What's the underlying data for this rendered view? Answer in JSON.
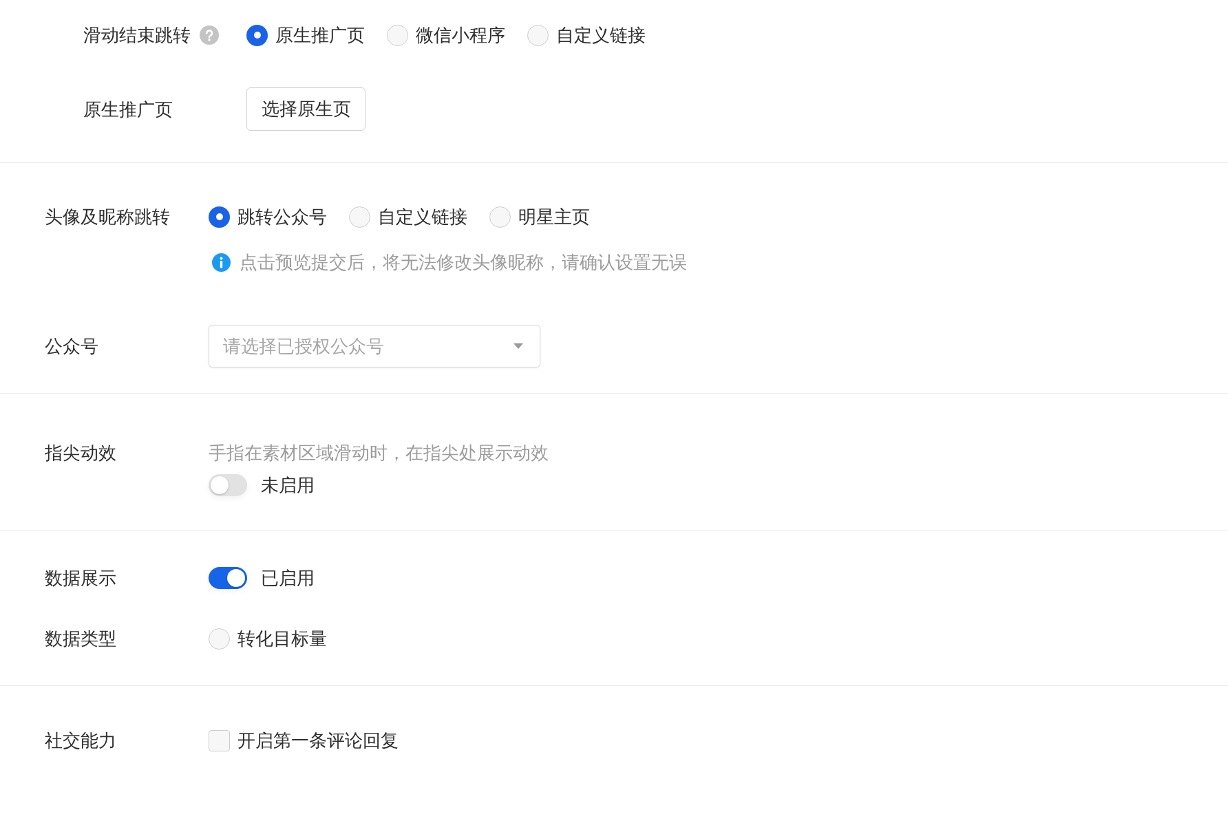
{
  "sections": [
    {
      "kind": "subform",
      "rows": [
        {
          "kind": "radio",
          "label": "滑动结束跳转",
          "help": true,
          "options": [
            {
              "label": "原生推广页",
              "selected": true
            },
            {
              "label": "微信小程序",
              "selected": false
            },
            {
              "label": "自定义链接",
              "selected": false
            }
          ]
        },
        {
          "kind": "button",
          "label": "原生推广页",
          "button": "选择原生页"
        }
      ]
    },
    {
      "kind": "form",
      "rows": [
        {
          "kind": "radio",
          "label": "头像及昵称跳转",
          "options": [
            {
              "label": "跳转公众号",
              "selected": true
            },
            {
              "label": "自定义链接",
              "selected": false
            },
            {
              "label": "明星主页",
              "selected": false
            }
          ],
          "notice": "点击预览提交后，将无法修改头像昵称，请确认设置无误"
        },
        {
          "kind": "select",
          "label": "公众号",
          "placeholder": "请选择已授权公众号"
        }
      ]
    },
    {
      "kind": "form",
      "rows": [
        {
          "kind": "switch",
          "label": "指尖动效",
          "hint": "手指在素材区域滑动时，在指尖处展示动效",
          "on": false,
          "status": "未启用"
        }
      ]
    },
    {
      "kind": "form",
      "rows": [
        {
          "kind": "switch",
          "label": "数据展示",
          "on": true,
          "status": "已启用"
        },
        {
          "kind": "radio",
          "label": "数据类型",
          "options": [
            {
              "label": "转化目标量",
              "selected": false
            }
          ]
        }
      ]
    },
    {
      "kind": "form",
      "rows": [
        {
          "kind": "checkbox",
          "label": "社交能力",
          "checkbox": {
            "label": "开启第一条评论回复",
            "checked": false
          }
        }
      ]
    }
  ]
}
